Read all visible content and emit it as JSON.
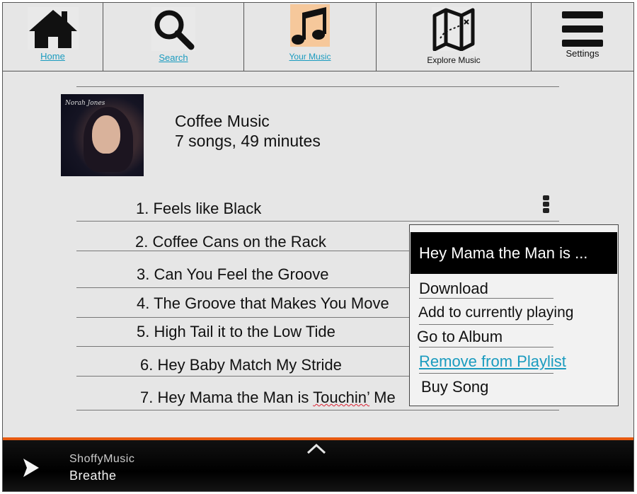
{
  "nav": {
    "home": "Home",
    "search": "Search",
    "your_music": "Your Music",
    "explore": "Explore Music",
    "settings": "Settings"
  },
  "playlist": {
    "title": "Coffee Music",
    "meta": "7 songs, 49 minutes",
    "cover_text": "Norah Jones"
  },
  "songs": [
    "1. Feels like Black",
    "2. Coffee Cans on the Rack",
    "3. Can You Feel the Groove",
    "4. The Groove that Makes You Move",
    "5. High Tail it to the Low Tide",
    "6. Hey Baby Match My Stride",
    "7. Hey Mama the Man is Touchin’ Me"
  ],
  "context_menu": {
    "header": "Hey Mama the Man is ...",
    "items": [
      "Download",
      "Add to currently playing",
      "Go to Album",
      "Remove from Playlist",
      "Buy Song"
    ]
  },
  "player": {
    "app_name": "ShoffyMusic",
    "now_playing": "Breathe"
  },
  "colors": {
    "link": "#1a9bbf",
    "accent_bar": "#e85a10",
    "your_music_icon_bg": "#f6c89b"
  }
}
